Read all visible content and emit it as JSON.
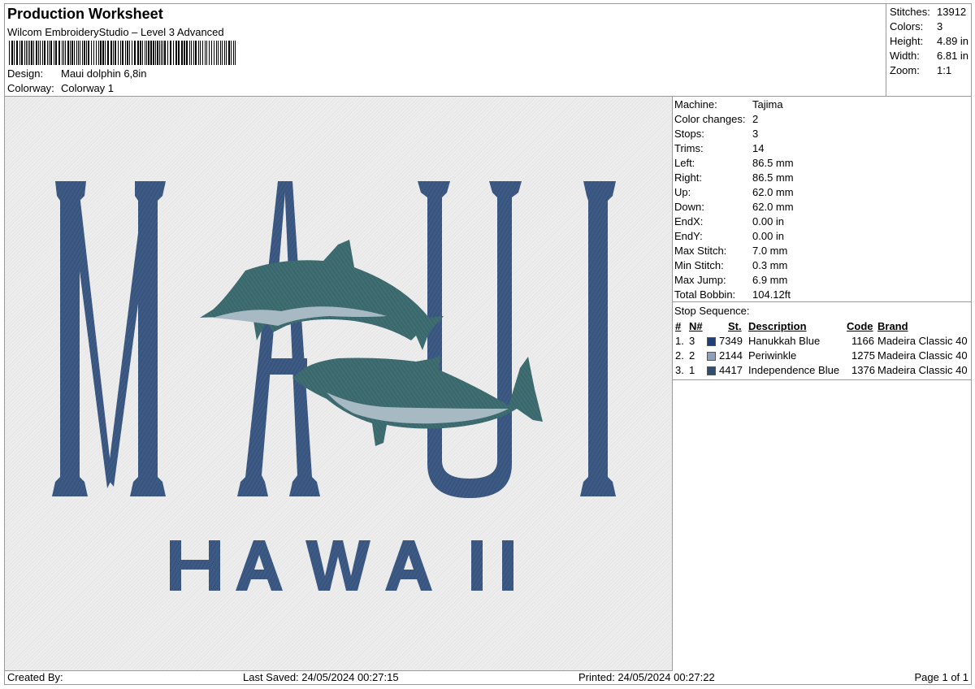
{
  "header": {
    "title": "Production Worksheet",
    "subtitle": "Wilcom EmbroideryStudio – Level 3 Advanced",
    "design_label": "Design:",
    "design_value": "Maui dolphin 6,8in",
    "colorway_label": "Colorway:",
    "colorway_value": "Colorway 1"
  },
  "summary": [
    {
      "label": "Stitches:",
      "value": "13912"
    },
    {
      "label": "Colors:",
      "value": "3"
    },
    {
      "label": "Height:",
      "value": "4.89 in"
    },
    {
      "label": "Width:",
      "value": "6.81 in"
    },
    {
      "label": "Zoom:",
      "value": "1:1"
    }
  ],
  "machine": [
    {
      "label": "Machine:",
      "value": "Tajima"
    },
    {
      "label": "Color changes:",
      "value": "2"
    },
    {
      "label": "Stops:",
      "value": "3"
    },
    {
      "label": "Trims:",
      "value": "14"
    },
    {
      "label": "Left:",
      "value": "86.5 mm"
    },
    {
      "label": "Right:",
      "value": "86.5 mm"
    },
    {
      "label": "Up:",
      "value": "62.0 mm"
    },
    {
      "label": "Down:",
      "value": "62.0 mm"
    },
    {
      "label": "EndX:",
      "value": "0.00 in"
    },
    {
      "label": "EndY:",
      "value": "0.00 in"
    },
    {
      "label": "Max Stitch:",
      "value": "7.0 mm"
    },
    {
      "label": "Min Stitch:",
      "value": "0.3 mm"
    },
    {
      "label": "Max Jump:",
      "value": "6.9 mm"
    },
    {
      "label": "Total Bobbin:",
      "value": "104.12ft"
    }
  ],
  "stop_sequence": {
    "title": "Stop Sequence:",
    "headers": {
      "num": "#",
      "n": "N#",
      "st": "St.",
      "description": "Description",
      "code": "Code",
      "brand": "Brand"
    },
    "rows": [
      {
        "num": "1.",
        "n": "3",
        "color": "#1f3f7a",
        "st": "7349",
        "description": "Hanukkah Blue",
        "code": "1166",
        "brand": "Madeira Classic 40"
      },
      {
        "num": "2.",
        "n": "2",
        "color": "#8fa0b8",
        "st": "2144",
        "description": "Periwinkle",
        "code": "1275",
        "brand": "Madeira Classic 40"
      },
      {
        "num": "3.",
        "n": "1",
        "color": "#2f4f6e",
        "st": "4417",
        "description": "Independence Blue",
        "code": "1376",
        "brand": "Madeira Classic 40"
      }
    ]
  },
  "design_art": {
    "letters": "MAUI",
    "sub_text": "HAWAII",
    "letter_color": "#3d5a85",
    "dolphin_color": "#3f6e72",
    "belly_color": "#a7b9c2"
  },
  "footer": {
    "created_by": "Created By:",
    "last_saved": "Last Saved: 24/05/2024 00:27:15",
    "printed": "Printed: 24/05/2024 00:27:22",
    "page": "Page 1 of 1"
  }
}
